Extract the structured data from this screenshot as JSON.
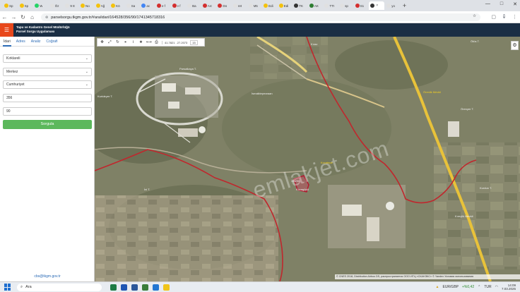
{
  "browser": {
    "tabs": [
      {
        "label": "Sp",
        "color": "#f4c20d"
      },
      {
        "label": "Sp",
        "color": "#f4c20d"
      },
      {
        "label": "W",
        "color": "#25d366"
      },
      {
        "label": "Öz",
        "color": "#e0e0e0"
      },
      {
        "label": "9 8",
        "color": "#e0e0e0"
      },
      {
        "label": "No",
        "color": "#f4c20d"
      },
      {
        "label": "Ağ",
        "color": "#f4c20d"
      },
      {
        "label": "Kö",
        "color": "#f4c20d"
      },
      {
        "label": "Sa",
        "color": "#e0e0e0"
      },
      {
        "label": "ac",
        "color": "#4285f4"
      },
      {
        "label": "e f",
        "color": "#d32f2f"
      },
      {
        "label": "e f",
        "color": "#d32f2f"
      },
      {
        "label": "Ba",
        "color": "#e0e0e0"
      },
      {
        "label": "Arc",
        "color": "#d32f2f"
      },
      {
        "label": "Dü",
        "color": "#d32f2f"
      },
      {
        "label": "ret",
        "color": "#e0e0e0"
      },
      {
        "label": "M5",
        "color": "#e0e0e0"
      },
      {
        "label": "Edi",
        "color": "#f4c20d"
      },
      {
        "label": "Edi",
        "color": "#f4c20d"
      },
      {
        "label": "TK",
        "color": "#333333"
      },
      {
        "label": "AK",
        "color": "#2e7d32"
      },
      {
        "label": "TTI",
        "color": "#e0e0e0"
      },
      {
        "label": "sp",
        "color": "#e0e0e0"
      },
      {
        "label": "S1",
        "color": "#d32f2f"
      },
      {
        "label": "",
        "color": "#333333",
        "active": true
      },
      {
        "label": "yo",
        "color": "#e0e0e0"
      }
    ],
    "url": "parselsorgu.tkgm.gov.tr/#ara/idari/164528/356/90/1741345718316",
    "new_tab": "+",
    "window_controls": [
      "—",
      "□",
      "✕"
    ]
  },
  "app": {
    "title_line1": "Tapu ve Kadastro Genel Müdürlüğü",
    "title_line2": "Parsel Sorgu Uygulaması",
    "menu_icon": "☰"
  },
  "sidebar": {
    "tabs": [
      "İdari",
      "Adres",
      "Analiz",
      "Coğrafi"
    ],
    "province": "Kırklareli",
    "district": "Merkez",
    "neighborhood": "Cumhuriyet",
    "block": "356",
    "parcel": "90",
    "query_button": "Sorgula",
    "email": "cbs@tkgm.gov.tr"
  },
  "map": {
    "coords": "41.7821 . 27.2073",
    "zoom": "15",
    "watermark": "emlakjet.com",
    "copyright": "© CNES 2018, Distribution Airbus DS, распространяется ООО ИТЦ «СКАНЭКС» © Yandex Условия использования",
    "labels": {
      "top_center": "Parsalkaya T.",
      "left": "Kurtdeyer T.",
      "center_left": "İsmaiktepearaan",
      "right_a": "Örenlik Mevkii",
      "right_b": "Örenyer T.",
      "far_right": "Kurdun T.",
      "top_right": "Ötüs T.",
      "center": "Kocatepe",
      "lower_center": "Kocagörül",
      "left_small": "İni T.",
      "top_road": "Kıraz",
      "parcel_label": "356/90",
      "lower_right": "Kıreçlik Mevkii"
    }
  },
  "taskbar": {
    "search_placeholder": "Ara",
    "currency": "EUR/GBP",
    "change": "+%0,42",
    "lang": "TUR",
    "time": "14:09",
    "date": "7.03.2025"
  }
}
